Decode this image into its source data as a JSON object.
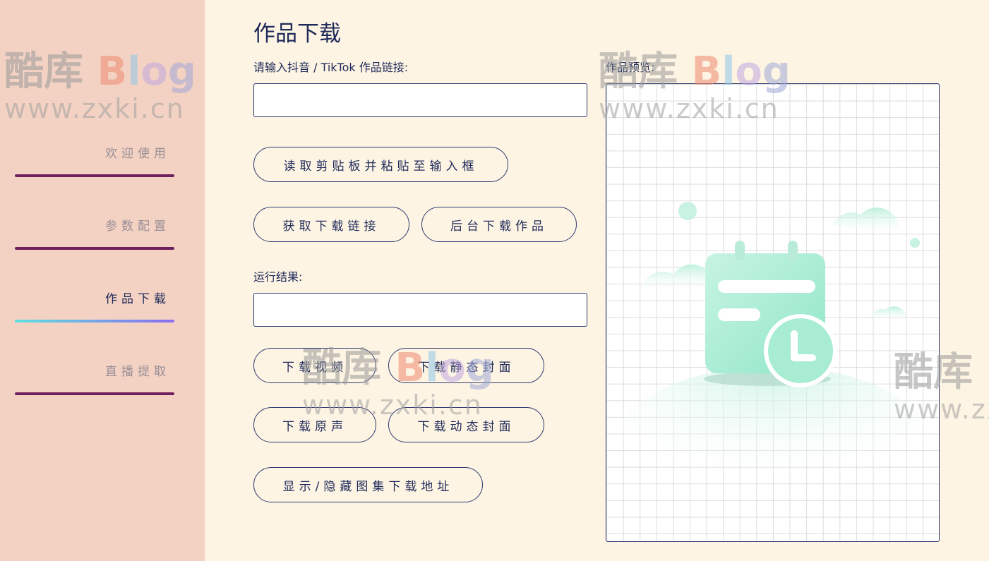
{
  "sidebar": {
    "items": [
      {
        "label": "欢迎使用",
        "active": false
      },
      {
        "label": "参数配置",
        "active": false
      },
      {
        "label": "作品下载",
        "active": true
      },
      {
        "label": "直播提取",
        "active": false
      }
    ]
  },
  "watermark": {
    "cn": "酷库",
    "blog": "Blog",
    "url": "www.zxki.cn"
  },
  "main": {
    "title": "作品下载",
    "link_label": "请输入抖音 / TikTok 作品链接:",
    "link_value": "",
    "paste_button": "读取剪贴板并粘贴至输入框",
    "get_link_button": "获取下载链接",
    "bg_download_button": "后台下载作品",
    "result_label": "运行结果:",
    "result_value": "",
    "download_video_button": "下载视频",
    "download_static_cover_button": "下载静态封面",
    "download_audio_button": "下载原声",
    "download_dynamic_cover_button": "下载动态封面",
    "toggle_gallery_button": "显示/隐藏图集下载地址"
  },
  "preview": {
    "label": "作品预览:",
    "empty_icon": "calendar-clock-illustration"
  },
  "colors": {
    "sidebar_bg": "#f3d2c3",
    "page_bg": "#fdf4e3",
    "text": "#1f2a5a",
    "nav_bar": "#6e1f5e",
    "accent_gradient_start": "#5ee0e0",
    "accent_gradient_end": "#8a6cf0"
  }
}
